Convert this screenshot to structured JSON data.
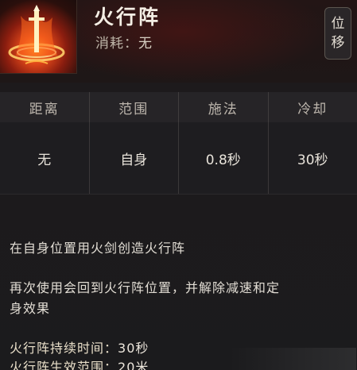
{
  "skill": {
    "name": "火行阵",
    "cost_label": "消耗：",
    "cost_value": "无",
    "tag": [
      "位",
      "移"
    ]
  },
  "stats": {
    "headers": [
      "距离",
      "范围",
      "施法",
      "冷却"
    ],
    "values": [
      "无",
      "自身",
      "0.8秒",
      "30秒"
    ]
  },
  "description": {
    "lines": [
      "在自身位置用火剑创造火行阵",
      "再次使用会回到火行阵位置，并解除减速和定",
      "身效果"
    ]
  },
  "details": [
    {
      "label": "火行阵持续时间：",
      "value": "30秒"
    },
    {
      "label": "火行阵生效范围：",
      "value": "20米"
    }
  ],
  "colors": {
    "background": "#1b1a1c",
    "header_bg": "#262427",
    "text": "#e2ddd4",
    "fire_accent": "#e2481a"
  },
  "icons": {
    "skill": "fire-sword-array-icon"
  }
}
